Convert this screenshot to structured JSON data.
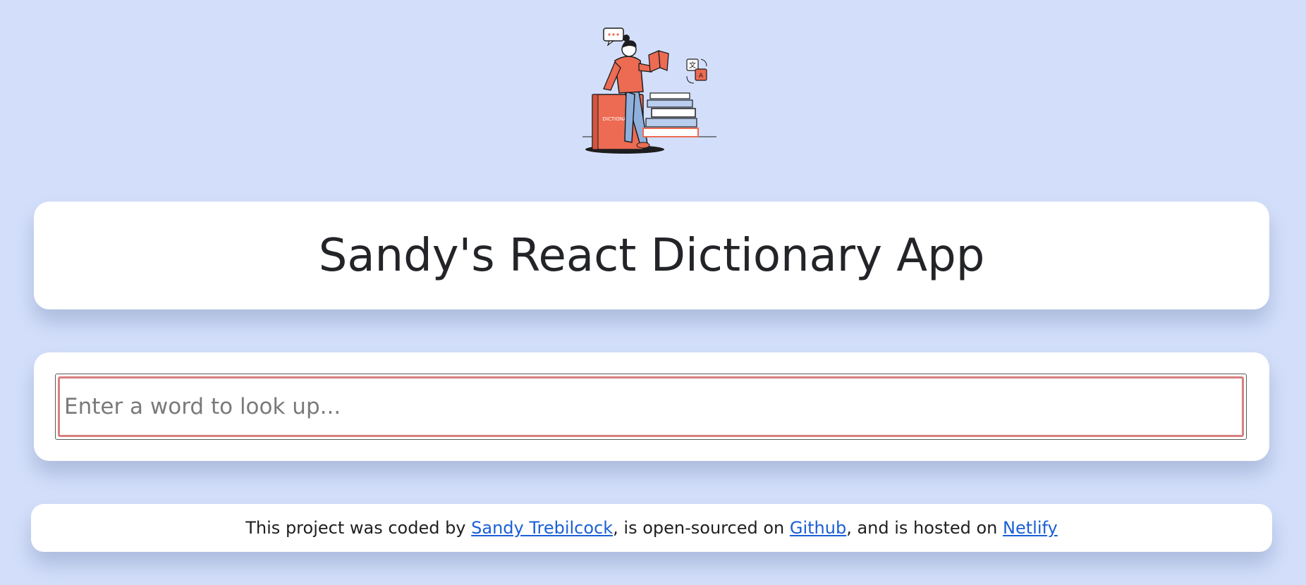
{
  "hero": {
    "book_label": "DICTIONARY",
    "translate_glyph": "文",
    "translate_letter": "A"
  },
  "header": {
    "title": "Sandy's React Dictionary App"
  },
  "search": {
    "placeholder": "Enter a word to look up...",
    "value": ""
  },
  "footer": {
    "text_1": "This project was coded by ",
    "author_link": "Sandy Trebilcock",
    "text_2": ", is open-sourced on ",
    "github_link": "Github",
    "text_3": ", and is hosted on ",
    "netlify_link": "Netlify"
  },
  "colors": {
    "background": "#d3dffa",
    "accent": "#ec6b52",
    "link": "#1a5fd6",
    "input_border": "#d87f7f"
  }
}
